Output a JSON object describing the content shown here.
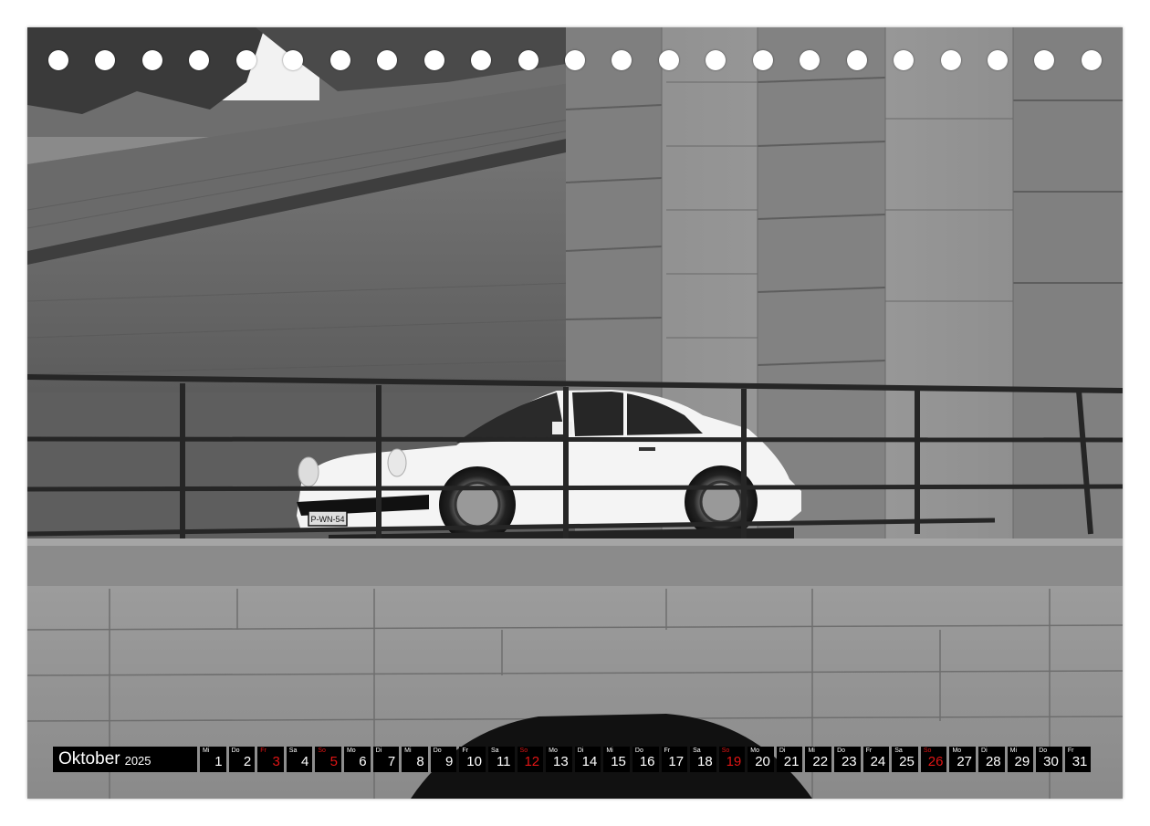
{
  "calendar": {
    "month": "Oktober",
    "year": "2025",
    "days": [
      {
        "dow": "Mi",
        "num": "1",
        "sunday": false
      },
      {
        "dow": "Do",
        "num": "2",
        "sunday": false
      },
      {
        "dow": "Fr",
        "num": "3",
        "sunday": true
      },
      {
        "dow": "Sa",
        "num": "4",
        "sunday": false
      },
      {
        "dow": "So",
        "num": "5",
        "sunday": true
      },
      {
        "dow": "Mo",
        "num": "6",
        "sunday": false
      },
      {
        "dow": "Di",
        "num": "7",
        "sunday": false
      },
      {
        "dow": "Mi",
        "num": "8",
        "sunday": false
      },
      {
        "dow": "Do",
        "num": "9",
        "sunday": false
      },
      {
        "dow": "Fr",
        "num": "10",
        "sunday": false
      },
      {
        "dow": "Sa",
        "num": "11",
        "sunday": false
      },
      {
        "dow": "So",
        "num": "12",
        "sunday": true
      },
      {
        "dow": "Mo",
        "num": "13",
        "sunday": false
      },
      {
        "dow": "Di",
        "num": "14",
        "sunday": false
      },
      {
        "dow": "Mi",
        "num": "15",
        "sunday": false
      },
      {
        "dow": "Do",
        "num": "16",
        "sunday": false
      },
      {
        "dow": "Fr",
        "num": "17",
        "sunday": false
      },
      {
        "dow": "Sa",
        "num": "18",
        "sunday": false
      },
      {
        "dow": "So",
        "num": "19",
        "sunday": true
      },
      {
        "dow": "Mo",
        "num": "20",
        "sunday": false
      },
      {
        "dow": "Di",
        "num": "21",
        "sunday": false
      },
      {
        "dow": "Mi",
        "num": "22",
        "sunday": false
      },
      {
        "dow": "Do",
        "num": "23",
        "sunday": false
      },
      {
        "dow": "Fr",
        "num": "24",
        "sunday": false
      },
      {
        "dow": "Sa",
        "num": "25",
        "sunday": false
      },
      {
        "dow": "So",
        "num": "26",
        "sunday": true
      },
      {
        "dow": "Mo",
        "num": "27",
        "sunday": false
      },
      {
        "dow": "Di",
        "num": "28",
        "sunday": false
      },
      {
        "dow": "Mi",
        "num": "29",
        "sunday": false
      },
      {
        "dow": "Do",
        "num": "30",
        "sunday": false
      },
      {
        "dow": "Fr",
        "num": "31",
        "sunday": false
      }
    ]
  },
  "photo": {
    "plate_text": "P-WN-54"
  },
  "colors": {
    "holiday": "#e01515",
    "bar": "#000000"
  }
}
